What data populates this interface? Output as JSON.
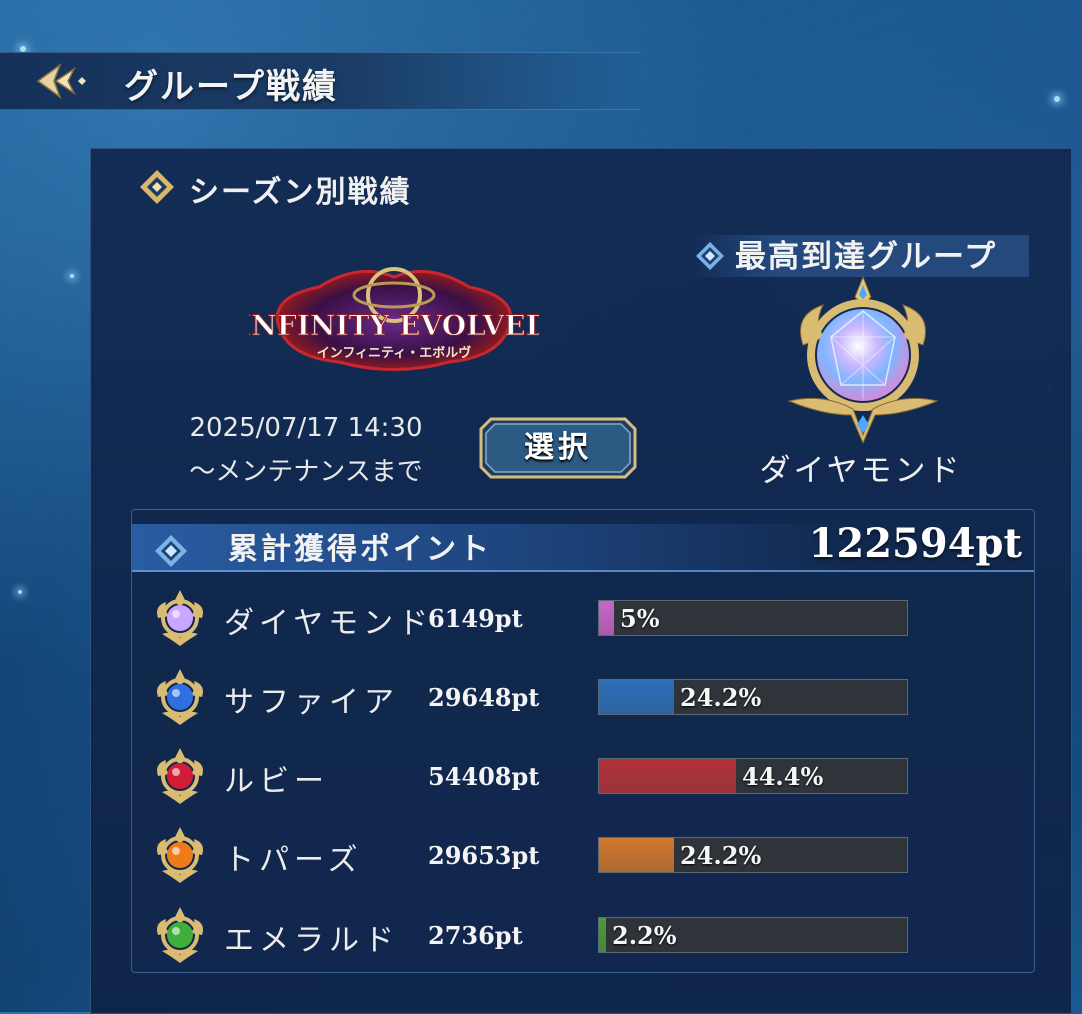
{
  "header": {
    "title": "グループ戦績"
  },
  "season": {
    "section_title": "シーズン別戦績",
    "logo_text": "INFINITY EVOLVED",
    "logo_subtext": "インフィニティ・エボルヴ",
    "period_line1": "2025/07/17 14:30",
    "period_line2": "〜メンテナンスまで",
    "select_label": "選択"
  },
  "best_group": {
    "title": "最高到達グループ",
    "name": "ダイヤモンド"
  },
  "points": {
    "title": "累計獲得ポイント",
    "total": "122594pt",
    "rows": [
      {
        "name": "ダイヤモンド",
        "points": "6149pt",
        "percent_label": "5%",
        "fraction": 0.05,
        "color": "#c766c8",
        "icon": "diamond-gem-icon"
      },
      {
        "name": "サファイア",
        "points": "29648pt",
        "percent_label": "24.2%",
        "fraction": 0.242,
        "color": "#2d6fb8",
        "icon": "sapphire-gem-icon"
      },
      {
        "name": "ルビー",
        "points": "54408pt",
        "percent_label": "44.4%",
        "fraction": 0.444,
        "color": "#b3323a",
        "icon": "ruby-gem-icon"
      },
      {
        "name": "トパーズ",
        "points": "29653pt",
        "percent_label": "24.2%",
        "fraction": 0.242,
        "color": "#d0782f",
        "icon": "topaz-gem-icon"
      },
      {
        "name": "エメラルド",
        "points": "2736pt",
        "percent_label": "2.2%",
        "fraction": 0.022,
        "color": "#4e9a3a",
        "icon": "emerald-gem-icon"
      }
    ]
  }
}
